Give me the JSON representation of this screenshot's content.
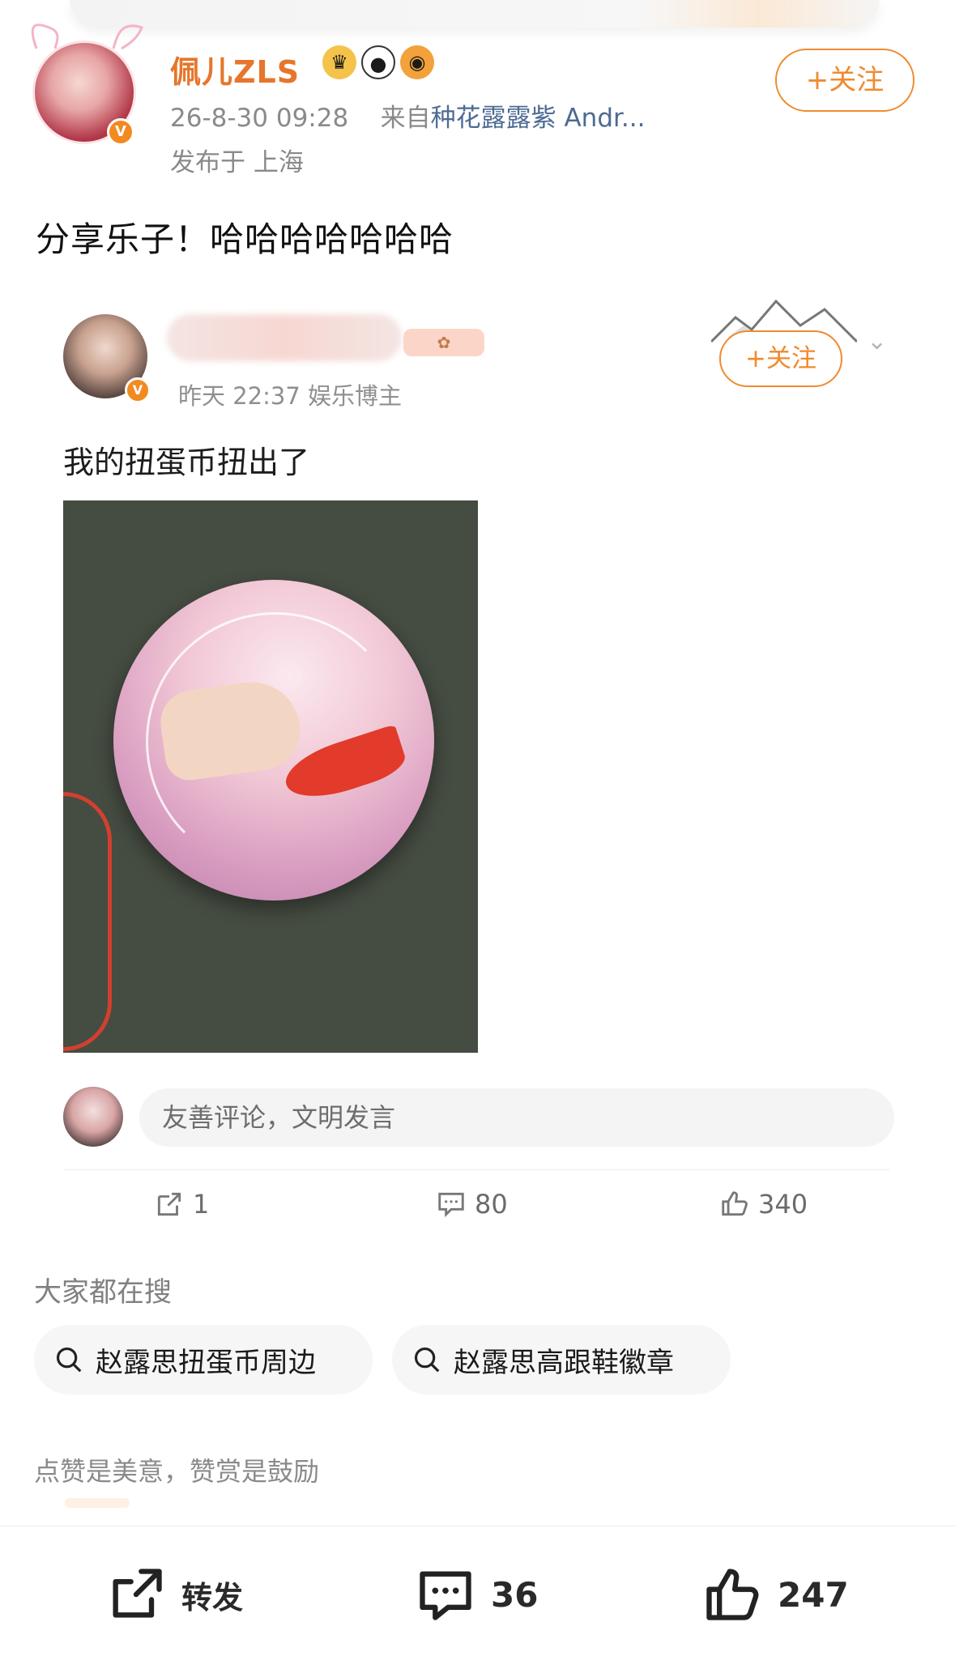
{
  "post": {
    "username": "佩儿ZLS",
    "timestamp": "26-8-30 09:28",
    "source_prefix": "来自",
    "source": "种花露露紫 Andr...",
    "location": "发布于 上海",
    "follow": "+关注",
    "text": "分享乐子！哈哈哈哈哈哈哈",
    "verified_badge": "V"
  },
  "repost": {
    "meta": "昨天 22:37  娱乐博主",
    "follow": "+关注",
    "text": "我的扭蛋币扭出了",
    "comment_placeholder": "友善评论，文明发言",
    "verified_badge": "V"
  },
  "actions": {
    "repost_count": "1",
    "comment_count": "80",
    "like_count": "340"
  },
  "search": {
    "title": "大家都在搜",
    "chips": [
      "赵露思扭蛋币周边",
      "赵露思高跟鞋徽章"
    ]
  },
  "reward": {
    "title": "点赞是美意，赞赏是鼓励"
  },
  "bottom_bar": {
    "forward_label": "转发",
    "comment_count": "36",
    "like_count": "247"
  },
  "colors": {
    "accent_orange": "#f08a2e",
    "username_orange": "#e6762b",
    "link_blue": "#4d6b93"
  }
}
